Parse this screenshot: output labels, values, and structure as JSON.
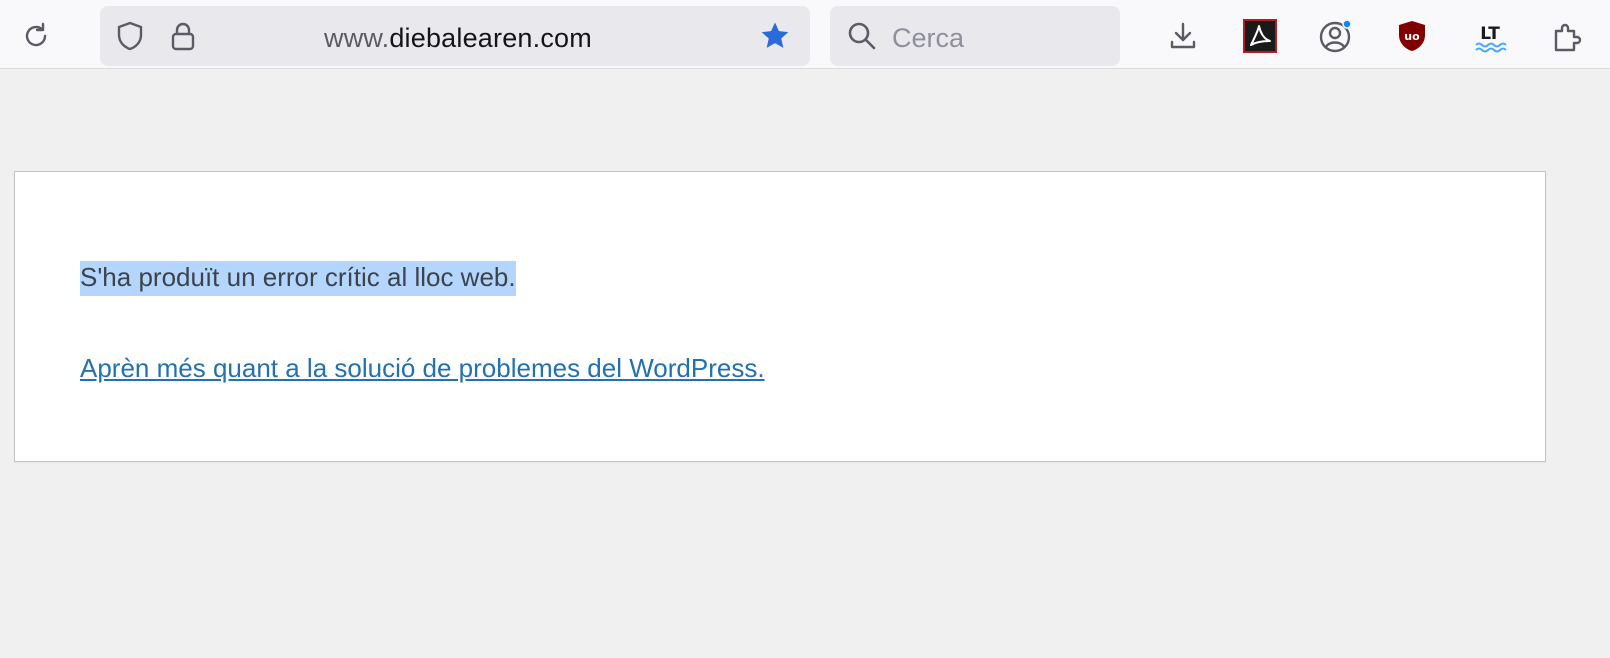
{
  "browser": {
    "url_prefix": "www.",
    "url_domain": "diebalearen.com",
    "search_placeholder": "Cerca",
    "bookmark_star_color": "#2a6ad9",
    "extensions": [
      "download-icon",
      "adobe-acrobat-icon",
      "account-icon",
      "ublock-origin-icon",
      "languagetool-icon",
      "extensions-puzzle-icon"
    ]
  },
  "page": {
    "error_message": "S'ha produït un error crític al lloc web.",
    "help_link": "Aprèn més quant a la solució de problemes del WordPress.",
    "link_color": "#2271b1",
    "selection_color": "#b4d5fe"
  }
}
